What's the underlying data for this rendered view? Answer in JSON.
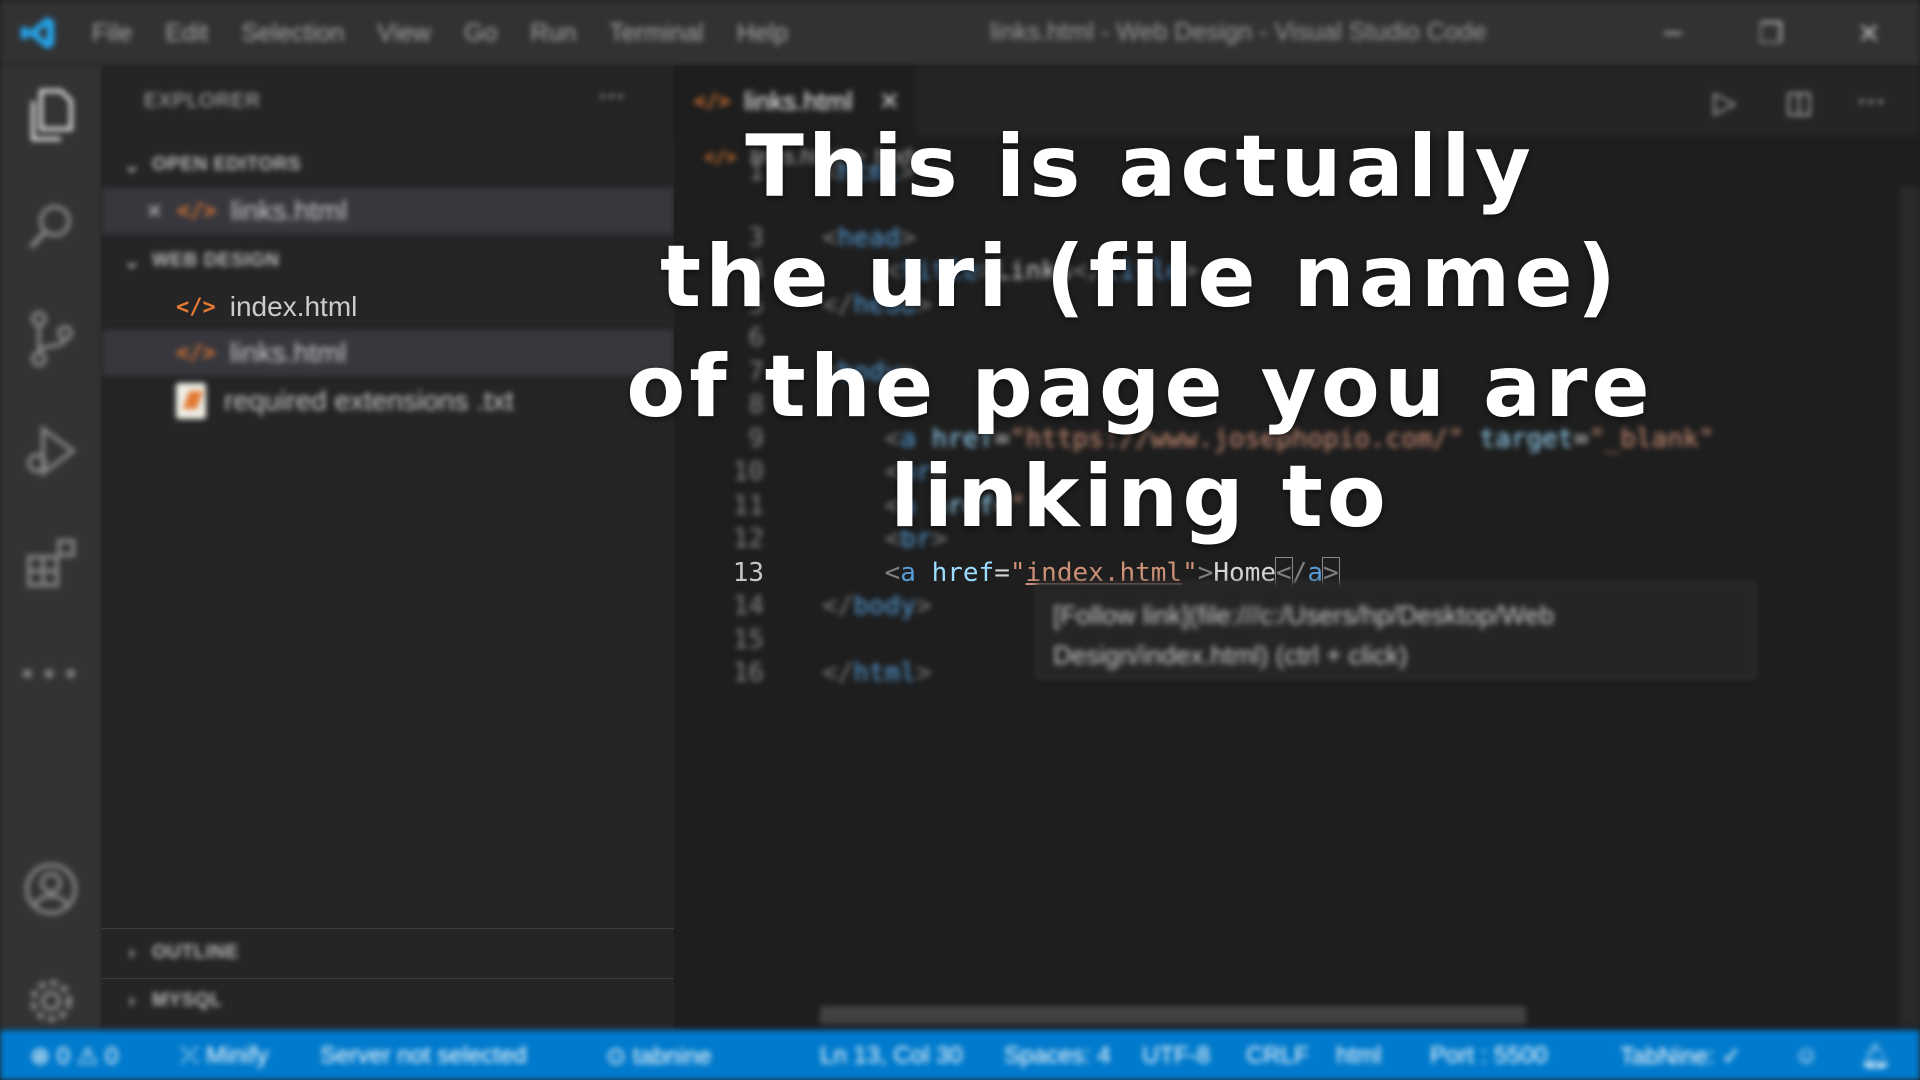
{
  "titlebar": {
    "logo_icon": "vscode-logo-icon",
    "menus": [
      "File",
      "Edit",
      "Selection",
      "View",
      "Go",
      "Run",
      "Terminal",
      "Help"
    ],
    "window_title": "links.html - Web Design - Visual Studio Code"
  },
  "activitybar": {
    "icons": [
      "explorer-icon",
      "search-icon",
      "source-control-icon",
      "run-debug-icon",
      "extensions-icon",
      "more-icon",
      "account-icon",
      "settings-gear-icon"
    ]
  },
  "sidebar": {
    "title": "EXPLORER",
    "more": "···",
    "open_editors": {
      "label": "OPEN EDITORS",
      "items": [
        {
          "close": "✕",
          "icon": "</>",
          "name": "links.html"
        }
      ]
    },
    "workspace": {
      "label": "WEB DESIGN",
      "items": [
        {
          "icon": "</>",
          "name": "index.html"
        },
        {
          "icon": "</>",
          "name": "links.html"
        },
        {
          "name": "required extensions .txt"
        }
      ]
    },
    "outline_label": "OUTLINE",
    "mysql_label": "MYSQL"
  },
  "editor": {
    "tab": {
      "icon": "</>",
      "name": "links.html",
      "close": "✕"
    },
    "breadcrumb": {
      "file": "links.html",
      "sep": ">",
      "node": "body"
    },
    "lines": [
      {
        "n": "1",
        "parts": [
          [
            "t-punc",
            "<"
          ],
          [
            "t-tag",
            "html"
          ],
          [
            "t-punc",
            ">"
          ]
        ]
      },
      {
        "n": "3",
        "parts": [
          [
            "t-punc",
            "<"
          ],
          [
            "t-tag",
            "head"
          ],
          [
            "t-punc",
            ">"
          ]
        ]
      },
      {
        "n": "4",
        "parts": [
          [
            "t-text",
            "    "
          ],
          [
            "t-punc",
            "<"
          ],
          [
            "t-tag",
            "title"
          ],
          [
            "t-punc",
            ">"
          ],
          [
            "t-text",
            "Links"
          ],
          [
            "t-punc",
            "</"
          ],
          [
            "t-tag",
            "title"
          ],
          [
            "t-punc",
            ">"
          ]
        ]
      },
      {
        "n": "5",
        "parts": [
          [
            "t-punc",
            "</"
          ],
          [
            "t-tag",
            "head"
          ],
          [
            "t-punc",
            ">"
          ]
        ]
      },
      {
        "n": "6",
        "parts": []
      },
      {
        "n": "7",
        "parts": [
          [
            "t-punc",
            "<"
          ],
          [
            "t-tag",
            "body"
          ],
          [
            "t-punc",
            ">"
          ]
        ]
      },
      {
        "n": "8",
        "parts": []
      },
      {
        "n": "9",
        "parts": [
          [
            "t-text",
            "    "
          ],
          [
            "t-punc",
            "<"
          ],
          [
            "t-tag",
            "a"
          ],
          [
            "t-text",
            " "
          ],
          [
            "t-attr",
            "href"
          ],
          [
            "t-text",
            "="
          ],
          [
            "t-str",
            "\"https://www.josephopio.com/\""
          ],
          [
            "t-text",
            " "
          ],
          [
            "t-attr",
            "target"
          ],
          [
            "t-text",
            "="
          ],
          [
            "t-str",
            "\"_blank\""
          ]
        ]
      },
      {
        "n": "10",
        "parts": [
          [
            "t-text",
            "    "
          ],
          [
            "t-punc",
            "<"
          ],
          [
            "t-tag",
            "br"
          ],
          [
            "t-punc",
            ">"
          ]
        ]
      },
      {
        "n": "11",
        "parts": [
          [
            "t-text",
            "    "
          ],
          [
            "t-punc",
            "<"
          ],
          [
            "t-tag",
            "a"
          ],
          [
            "t-text",
            " "
          ],
          [
            "t-attr",
            "href"
          ],
          [
            "t-text",
            "="
          ],
          [
            "t-str",
            "\""
          ]
        ]
      },
      {
        "n": "12",
        "parts": [
          [
            "t-text",
            "    "
          ],
          [
            "t-punc",
            "<"
          ],
          [
            "t-tag",
            "br"
          ],
          [
            "t-punc",
            ">"
          ]
        ]
      },
      {
        "n": "13",
        "parts": [
          [
            "t-text",
            "    "
          ],
          [
            "t-punc",
            "<"
          ],
          [
            "t-tag",
            "a"
          ],
          [
            "t-text",
            " "
          ],
          [
            "t-attr",
            "href"
          ],
          [
            "t-text",
            "="
          ],
          [
            "t-str",
            "\""
          ],
          [
            "t-str underline",
            "index.html"
          ],
          [
            "t-str",
            "\""
          ],
          [
            "t-punc",
            ">"
          ],
          [
            "t-text",
            "Home"
          ],
          [
            "t-punc bracket-hl",
            "<"
          ],
          [
            "t-punc",
            "/"
          ],
          [
            "t-tag",
            "a"
          ],
          [
            "t-punc bracket-hl",
            ">"
          ]
        ]
      },
      {
        "n": "14",
        "parts": [
          [
            "t-punc",
            "</"
          ],
          [
            "t-tag",
            "body"
          ],
          [
            "t-punc",
            ">"
          ]
        ]
      },
      {
        "n": "15",
        "parts": []
      },
      {
        "n": "16",
        "parts": [
          [
            "t-punc",
            "</"
          ],
          [
            "t-tag",
            "html"
          ],
          [
            "t-punc",
            ">"
          ]
        ]
      }
    ],
    "hover": {
      "line1": "[Follow link](file:///c:/Users/hp/Desktop/Web",
      "line2": "Design/index.html) (ctrl + click)"
    }
  },
  "statusbar": {
    "problems": "⊗ 0 ⚠ 0",
    "minify": "⤫ Minify",
    "server": "Server not selected",
    "tabnine": "⊙ tabnine",
    "position": "Ln 13, Col 30",
    "spaces": "Spaces: 4",
    "encoding": "UTF-8",
    "eol": "CRLF",
    "language": "html",
    "port": "Port : 5500",
    "tabnine_status": "TabNine: ✓"
  },
  "overlay": {
    "lines": [
      "This is actually",
      "the uri (file name)",
      "of the page you are",
      "linking to"
    ]
  }
}
